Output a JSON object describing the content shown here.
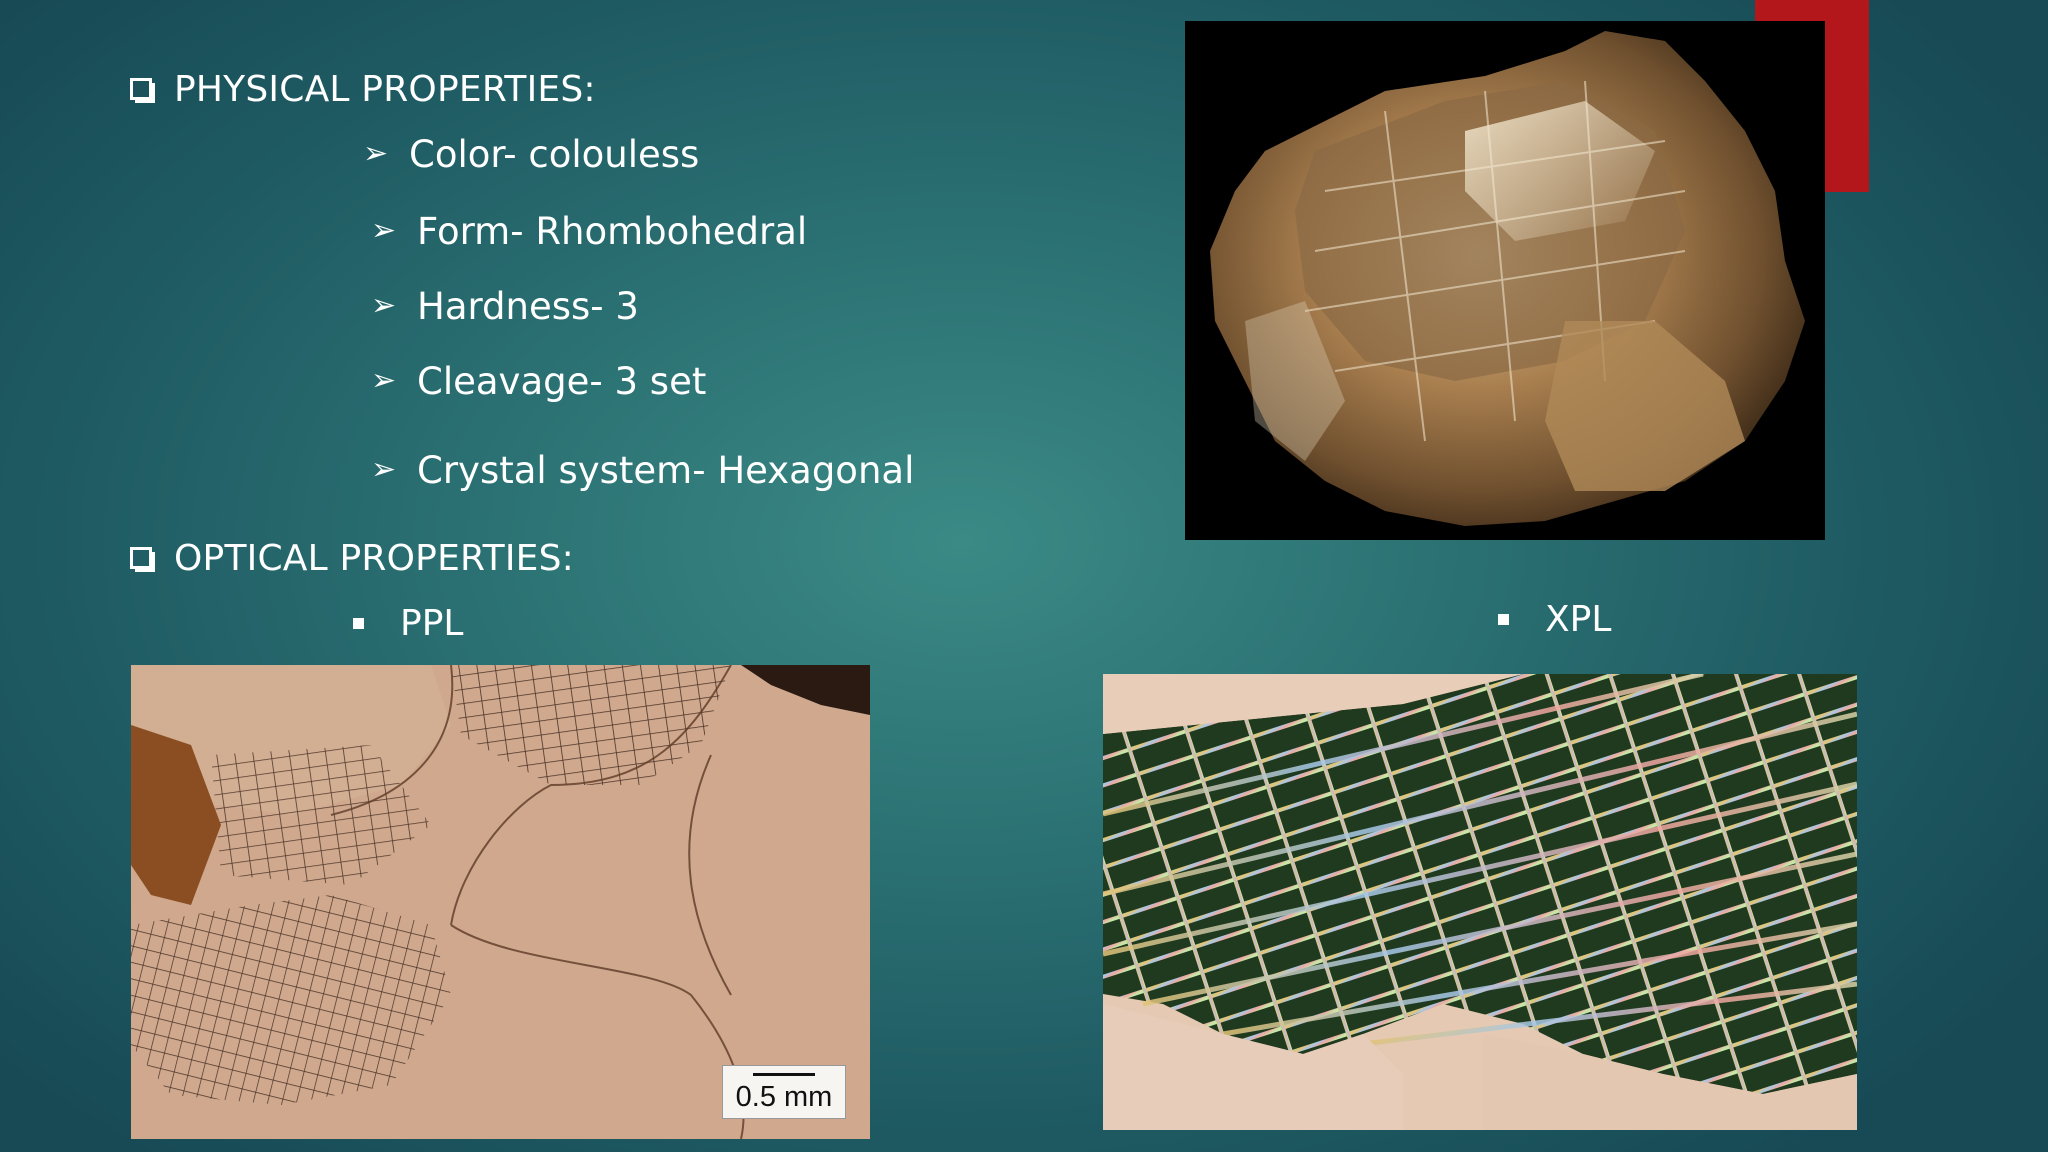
{
  "slide": {
    "physical_heading": "PHYSICAL PROPERTIES:",
    "optical_heading": "OPTICAL PROPERTIES:",
    "properties": [
      "Color-  colouless",
      "Form- Rhombohedral",
      "Hardness-  3",
      "Cleavage- 3 set",
      "Crystal system- Hexagonal"
    ],
    "ppl_label": "PPL",
    "xpl_label": "XPL",
    "scale_label": "0.5 mm"
  },
  "colors": {
    "background": "#2b7173",
    "accent": "#b3161b",
    "text": "#ffffff"
  },
  "icons": {
    "heading_bullet": "checkbox-square-icon",
    "list_bullet": "arrowhead-icon",
    "sub_bullet": "square-bullet-icon"
  }
}
